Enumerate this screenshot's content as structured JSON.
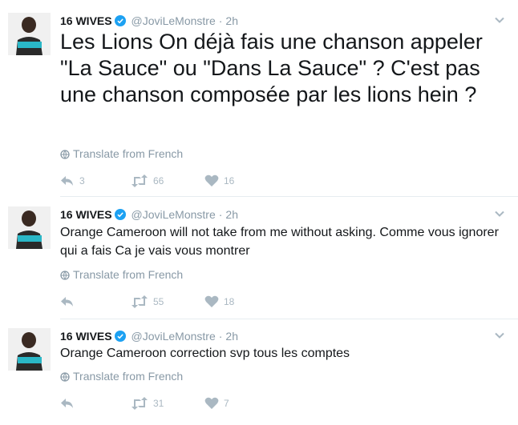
{
  "tweets": [
    {
      "name": "16 WIVES",
      "handle": "@JoviLeMonstre",
      "time": "2h",
      "text": "Les Lions On déjà fais une chanson appeler \"La Sauce\" ou \"Dans La Sauce\" ? C'est pas une chanson composée par les lions hein ?",
      "translate_label": "Translate from French",
      "reply_count": "3",
      "retweet_count": "66",
      "like_count": "16"
    },
    {
      "name": "16 WIVES",
      "handle": "@JoviLeMonstre",
      "time": "2h",
      "text": "Orange Cameroon will not take from me without asking. Comme vous ignorer qui a fais Ca je vais vous montrer",
      "translate_label": "Translate from French",
      "reply_count": "",
      "retweet_count": "55",
      "like_count": "18"
    },
    {
      "name": "16 WIVES",
      "handle": "@JoviLeMonstre",
      "time": "2h",
      "text": "Orange Cameroon correction svp tous les comptes",
      "translate_label": "Translate from French",
      "reply_count": "",
      "retweet_count": "31",
      "like_count": "7"
    }
  ],
  "separator": "·",
  "icons": {
    "verified": "verified-badge-icon",
    "chevron": "chevron-down-icon",
    "globe": "globe-icon",
    "reply": "reply-icon",
    "retweet": "retweet-icon",
    "like": "heart-icon"
  },
  "colors": {
    "verified": "#1da1f2",
    "muted": "#8899a6",
    "action": "#aab8c2",
    "text": "#14171a"
  }
}
